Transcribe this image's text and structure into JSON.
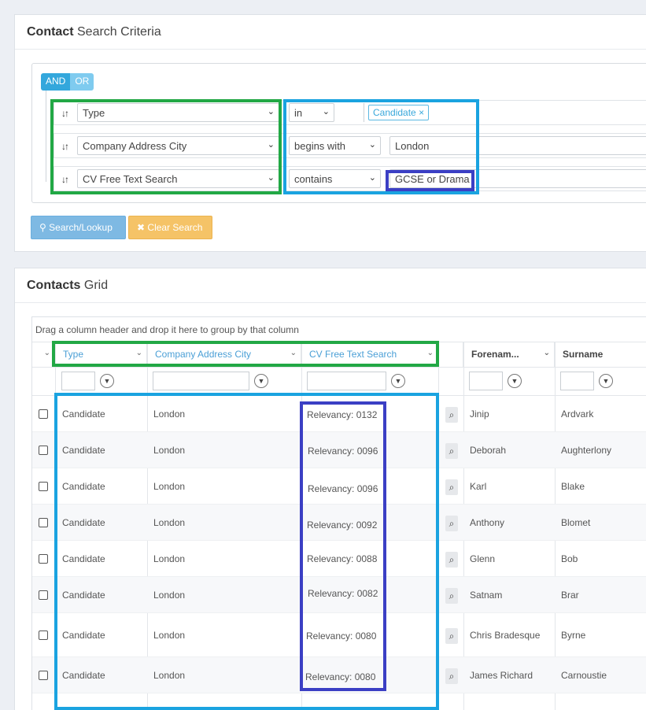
{
  "criteria": {
    "title_bold": "Contact",
    "title_rest": " Search Criteria",
    "and_label": "AND",
    "or_label": "OR",
    "rules": [
      {
        "field": "Type",
        "operator": "in",
        "value": "Candidate",
        "value_kind": "tag"
      },
      {
        "field": "Company Address City",
        "operator": "begins with",
        "value": "London",
        "value_kind": "text"
      },
      {
        "field": "CV Free Text Search",
        "operator": "contains",
        "value": "GCSE or Drama",
        "value_kind": "text"
      }
    ],
    "tag_remove": "×",
    "search_button": "Search/Lookup",
    "clear_button": "Clear Search"
  },
  "grid": {
    "title_bold": "Contacts",
    "title_rest": " Grid",
    "group_hint": "Drag a column header and drop it here to group by that column",
    "columns": [
      "Type",
      "Company Address City",
      "CV Free Text Search",
      "Forenam...",
      "Surname"
    ],
    "rows": [
      {
        "type": "Candidate",
        "city": "London",
        "relevancy": "Relevancy: 0132",
        "forename": "Jinip",
        "surname": "Ardvark"
      },
      {
        "type": "Candidate",
        "city": "London",
        "relevancy": "Relevancy: 0096",
        "forename": "Deborah",
        "surname": "Aughterlony"
      },
      {
        "type": "Candidate",
        "city": "London",
        "relevancy": "Relevancy: 0096",
        "forename": "Karl",
        "surname": "Blake"
      },
      {
        "type": "Candidate",
        "city": "London",
        "relevancy": "Relevancy: 0092",
        "forename": "Anthony",
        "surname": "Blomet"
      },
      {
        "type": "Candidate",
        "city": "London",
        "relevancy": "Relevancy: 0088",
        "forename": "Glenn",
        "surname": "Bob"
      },
      {
        "type": "Candidate",
        "city": "London",
        "relevancy": "Relevancy: 0082",
        "forename": "Satnam",
        "surname": "Brar"
      },
      {
        "type": "Candidate",
        "city": "London",
        "relevancy": "Relevancy: 0080",
        "forename": "Chris Bradesque",
        "surname": "Byrne"
      },
      {
        "type": "Candidate",
        "city": "London",
        "relevancy": "Relevancy: 0080",
        "forename": "James Richard",
        "surname": "Carnoustie"
      }
    ]
  },
  "colors": {
    "highlight_green": "#22a845",
    "highlight_cyan": "#1aa3e0",
    "highlight_indigo": "#3b3fc4"
  }
}
